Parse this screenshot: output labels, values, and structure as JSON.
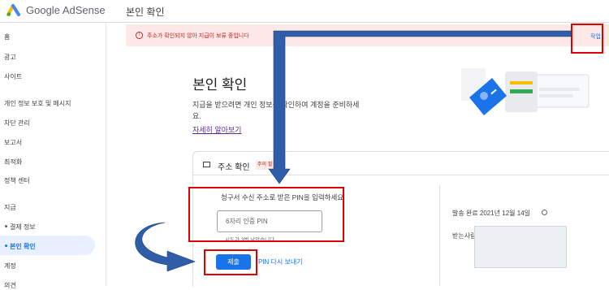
{
  "app": {
    "name": "Google AdSense"
  },
  "header": {
    "page_title": "본인 확인"
  },
  "sidebar": {
    "items": [
      {
        "label": "홈"
      },
      {
        "label": "광고"
      },
      {
        "label": "사이트"
      },
      {
        "label": "개인 정보 보호 및 메시지"
      },
      {
        "label": "차단 관리"
      },
      {
        "label": "보고서"
      },
      {
        "label": "최적화"
      },
      {
        "label": "정책 센터"
      },
      {
        "label": "지급"
      },
      {
        "label": "결제 정보"
      },
      {
        "label": "본인 확인"
      },
      {
        "label": "계정"
      },
      {
        "label": "의견"
      }
    ]
  },
  "alert": {
    "icon": "error-icon",
    "text": "주소가 확인되지 않아 지급이 보류 중입니다",
    "action": "작업"
  },
  "main": {
    "title": "본인 확인",
    "description": "지급을 받으려면 개인 정보를 확인하여 계정을 준비하세요.",
    "learn_more": "자세히 알아보기"
  },
  "card": {
    "title": "주소 확인",
    "badge": "주의 필요",
    "pin_label": "청구서 수신 주소로 받은 PIN을 입력하세요",
    "pin_placeholder": "6자리 인증 PIN",
    "attempts": "시도가 3번 남았습니다.",
    "submit": "제출",
    "resend": "PIN 다시 보내기",
    "sent_label": "발송 완료  2021년 12월 14일",
    "recipient_label": "받는사람"
  },
  "colors": {
    "accent": "#1a73e8",
    "alert_bg": "#fce8e6",
    "alert_text": "#c5221f",
    "annotation_red": "#e00000",
    "annotation_arrow": "#2f5da8"
  }
}
